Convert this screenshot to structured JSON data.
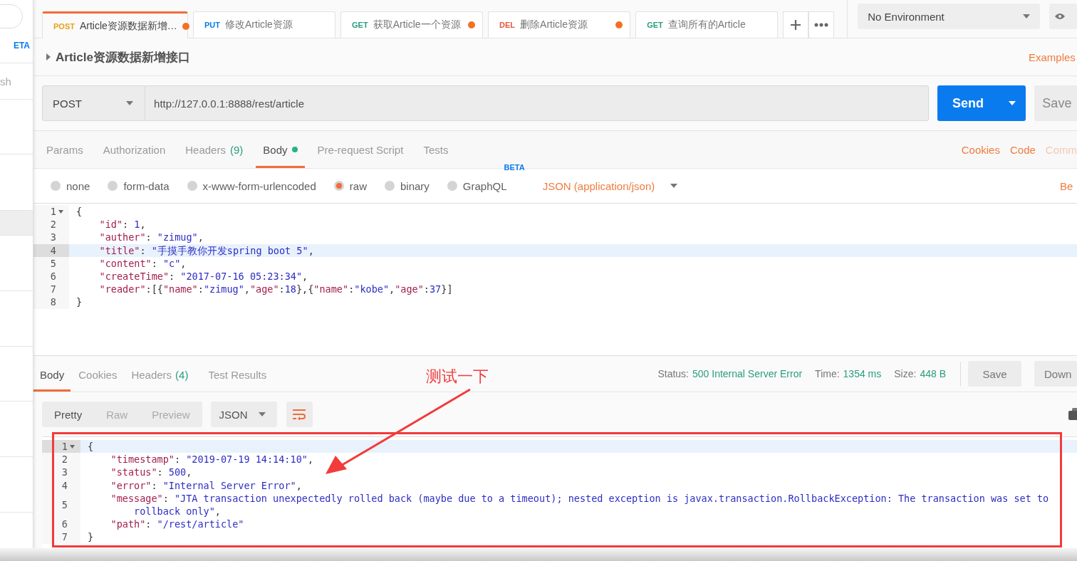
{
  "sidebar": {
    "items": [
      {
        "kind": "badge",
        "text": "ETA"
      },
      {
        "kind": "label",
        "text": "sh"
      }
    ]
  },
  "tabs": [
    {
      "method": "POST",
      "title": "Article资源数据新增…",
      "selected": true,
      "unsaved": true
    },
    {
      "method": "PUT",
      "title": "修改Article资源",
      "selected": false,
      "unsaved": false
    },
    {
      "method": "GET",
      "title": "获取Article一个资源",
      "selected": false,
      "unsaved": true
    },
    {
      "method": "DEL",
      "title": "删除Article资源",
      "selected": false,
      "unsaved": true
    },
    {
      "method": "GET",
      "title": "查询所有的Article",
      "selected": false,
      "unsaved": false
    }
  ],
  "environment": {
    "value": "No Environment"
  },
  "request": {
    "name": "Article资源数据新增接口",
    "examples": "Examples",
    "method": "POST",
    "url": "http://127.0.0.1:8888/rest/article",
    "send": "Send",
    "save": "Save"
  },
  "request_tabs": [
    {
      "label": "Params",
      "selected": false,
      "has_content": false
    },
    {
      "label": "Authorization",
      "selected": false,
      "has_content": false
    },
    {
      "label": "Headers",
      "count": "(9)",
      "selected": false,
      "has_content": false
    },
    {
      "label": "Body",
      "selected": true,
      "has_content": true
    },
    {
      "label": "Pre-request Script",
      "selected": false,
      "has_content": false
    },
    {
      "label": "Tests",
      "selected": false,
      "has_content": false
    }
  ],
  "request_links": [
    {
      "label": "Cookies",
      "disabled": false
    },
    {
      "label": "Code",
      "disabled": false
    },
    {
      "label": "Comm",
      "disabled": true
    }
  ],
  "body_modes": [
    {
      "label": "none",
      "selected": false
    },
    {
      "label": "form-data",
      "selected": false
    },
    {
      "label": "x-www-form-urlencoded",
      "selected": false
    },
    {
      "label": "raw",
      "selected": true
    },
    {
      "label": "binary",
      "selected": false
    },
    {
      "label": "GraphQL",
      "badge": "BETA",
      "selected": false
    }
  ],
  "content_type": "JSON (application/json)",
  "beautify": "Be",
  "request_body": {
    "lines": [
      {
        "number": "1",
        "text": "{",
        "foldable": true,
        "active": false
      },
      {
        "number": "2",
        "text": "    \"id\": 1,",
        "foldable": false,
        "active": false
      },
      {
        "number": "3",
        "text": "    \"auther\": \"zimug\",",
        "foldable": false,
        "active": false
      },
      {
        "number": "4",
        "text": "    \"title\": \"手摸手教你开发spring boot 5\",",
        "foldable": false,
        "active": true
      },
      {
        "number": "5",
        "text": "    \"content\": \"c\",",
        "foldable": false,
        "active": false
      },
      {
        "number": "6",
        "text": "    \"createTime\": \"2017-07-16 05:23:34\",",
        "foldable": false,
        "active": false
      },
      {
        "number": "7",
        "text": "    \"reader\":[{\"name\":\"zimug\",\"age\":18},{\"name\":\"kobe\",\"age\":37}]",
        "foldable": false,
        "active": false
      },
      {
        "number": "8",
        "text": "}",
        "foldable": false,
        "active": false
      }
    ]
  },
  "response_tabs": [
    {
      "label": "Body",
      "selected": true
    },
    {
      "label": "Cookies",
      "selected": false
    },
    {
      "label": "Headers",
      "count": "(4)",
      "selected": false
    },
    {
      "label": "Test Results",
      "selected": false
    }
  ],
  "response_stats": [
    {
      "label": "Status:",
      "value": "500 Internal Server Error"
    },
    {
      "label": "Time:",
      "value": "1354 ms"
    },
    {
      "label": "Size:",
      "value": "448 B"
    }
  ],
  "response_buttons": [
    "Save",
    "Down"
  ],
  "view_modes": [
    {
      "label": "Pretty",
      "selected": true
    },
    {
      "label": "Raw",
      "selected": false
    },
    {
      "label": "Preview",
      "selected": false
    }
  ],
  "format": "JSON",
  "response_body": {
    "lines": [
      {
        "number": "1",
        "text": "{",
        "foldable": true,
        "active": true
      },
      {
        "number": "2",
        "text": "    \"timestamp\": \"2019-07-19 14:14:10\",",
        "foldable": false,
        "active": false
      },
      {
        "number": "3",
        "text": "    \"status\": 500,",
        "foldable": false,
        "active": false
      },
      {
        "number": "4",
        "text": "    \"error\": \"Internal Server Error\",",
        "foldable": false,
        "active": false
      },
      {
        "number": "5",
        "text": "    \"message\": \"JTA transaction unexpectedly rolled back (maybe due to a timeout); nested exception is javax.transaction.RollbackException: The transaction was set to rollback only\",",
        "foldable": false,
        "active": false
      },
      {
        "number": "6",
        "text": "    \"path\": \"/rest/article\"",
        "foldable": false,
        "active": false
      },
      {
        "number": "7",
        "text": "}",
        "foldable": false,
        "active": false
      }
    ]
  },
  "annotation": {
    "text": "测试一下"
  }
}
